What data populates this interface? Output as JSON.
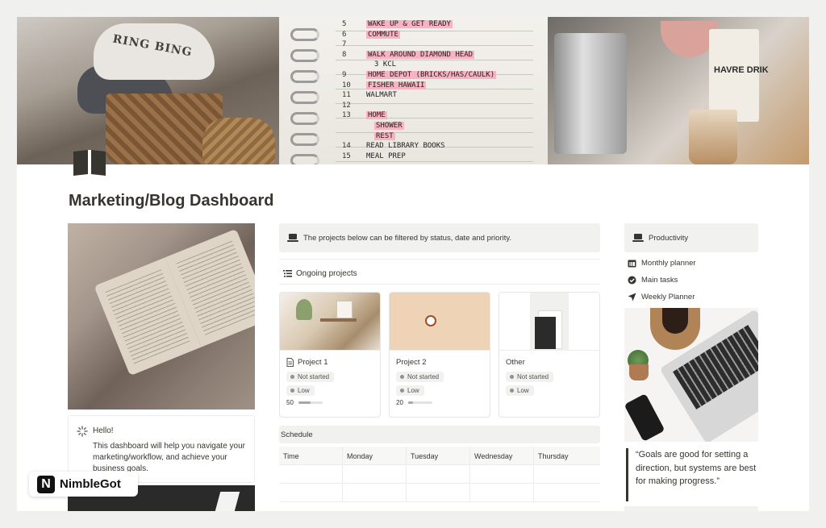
{
  "cover": {
    "pillow_text": "RING BING",
    "planner_rows": [
      {
        "num": "5",
        "text": "WAKE UP & GET READY",
        "highlight": true
      },
      {
        "num": "6",
        "text": "COMMUTE",
        "highlight": true
      },
      {
        "num": "7",
        "text": "",
        "highlight": false
      },
      {
        "num": "8",
        "text": "WALK AROUND DIAMOND HEAD",
        "highlight": true
      },
      {
        "num": "",
        "text": "3 KCL",
        "highlight": false
      },
      {
        "num": "9",
        "text": "HOME DEPOT (BRICKS/HAS/CAULK)",
        "highlight": true
      },
      {
        "num": "10",
        "text": "FISHER HAWAII",
        "highlight": true
      },
      {
        "num": "11",
        "text": "WALMART",
        "highlight": false
      },
      {
        "num": "12",
        "text": "",
        "highlight": false
      },
      {
        "num": "13",
        "text": "HOME",
        "highlight": true
      },
      {
        "num": "",
        "text": "SHOWER",
        "highlight": true
      },
      {
        "num": "",
        "text": "REST",
        "highlight": true
      },
      {
        "num": "14",
        "text": "READ LIBRARY BOOKS",
        "highlight": false
      },
      {
        "num": "15",
        "text": "MEAL PREP",
        "highlight": false
      }
    ],
    "carton_text": "HAVRE DRIK"
  },
  "page": {
    "title": "Marketing/Blog Dashboard"
  },
  "callout": {
    "greeting": "Hello!",
    "body": "This dashboard will help you navigate your marketing/workflow, and achieve your business goals."
  },
  "badge": {
    "mark": "N",
    "name": "NimbleGot"
  },
  "projects_banner": {
    "text": "The projects below can be filtered by status, date and priority."
  },
  "ongoing": {
    "label": "Ongoing projects"
  },
  "projects": [
    {
      "title": "Project 1",
      "status": "Not started",
      "priority": "Low",
      "progress": "50",
      "progress_value": 0.5
    },
    {
      "title": "Project 2",
      "status": "Not started",
      "priority": "Low",
      "progress": "20",
      "progress_value": 0.2
    },
    {
      "title": "Other",
      "status": "Not started",
      "priority": "Low",
      "progress": "",
      "progress_value": null
    }
  ],
  "schedule": {
    "title": "Schedule",
    "columns": [
      "Time",
      "Monday",
      "Tuesday",
      "Wednesday",
      "Thursday"
    ]
  },
  "productivity": {
    "title": "Productivity",
    "links": [
      {
        "label": "Monthly planner",
        "icon": "calendar-icon"
      },
      {
        "label": "Main tasks",
        "icon": "check-circle-icon"
      },
      {
        "label": "Weekly Planner",
        "icon": "send-icon"
      }
    ]
  },
  "quote": {
    "text": "“Goals are good for setting a direction, but systems are best for making progress.”"
  }
}
